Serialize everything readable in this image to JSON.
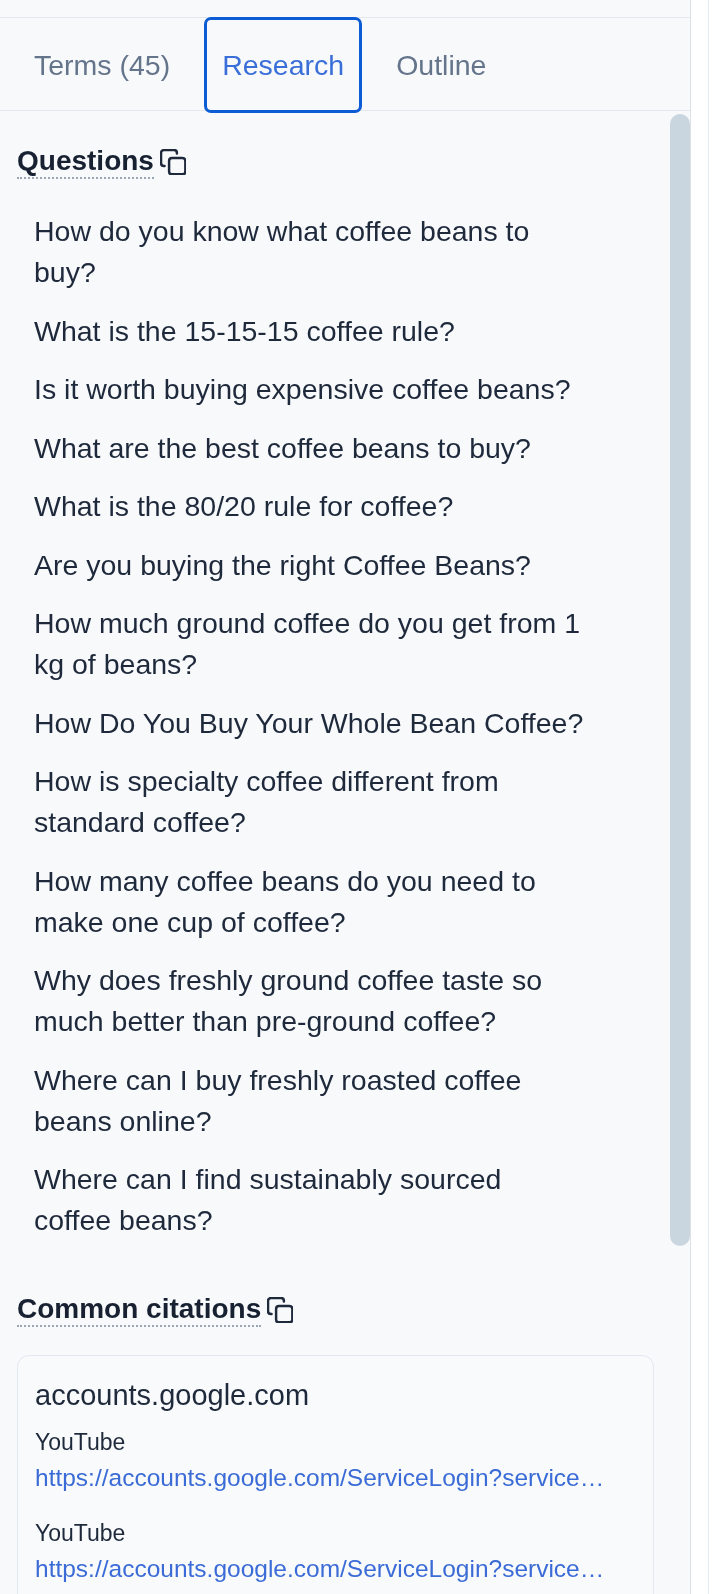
{
  "tabs": [
    {
      "label": "Terms (45)",
      "selected": false
    },
    {
      "label": "Research",
      "selected": true
    },
    {
      "label": "Outline",
      "selected": false
    }
  ],
  "questions": {
    "title": "Questions",
    "items": [
      "How do you know what coffee beans to buy?",
      "What is the 15-15-15 coffee rule?",
      "Is it worth buying expensive coffee beans?",
      "What are the best coffee beans to buy?",
      "What is the 80/20 rule for coffee?",
      "Are you buying the right Coffee Beans?",
      "How much ground coffee do you get from 1 kg of beans?",
      "How Do You Buy Your Whole Bean Coffee?",
      "How is specialty coffee different from standard coffee?",
      "How many coffee beans do you need to make one cup of coffee?",
      "Why does freshly ground coffee taste so much better than pre-ground coffee?",
      "Where can I buy freshly roasted coffee beans online?",
      "Where can I find sustainably sourced coffee beans?"
    ]
  },
  "common_citations": {
    "title": "Common citations",
    "sources": [
      {
        "domain": "accounts.google.com",
        "citations": [
          {
            "title": "YouTube",
            "url": "https://accounts.google.com/ServiceLogin?service…"
          },
          {
            "title": "YouTube",
            "url": "https://accounts.google.com/ServiceLogin?service…"
          }
        ]
      }
    ]
  }
}
